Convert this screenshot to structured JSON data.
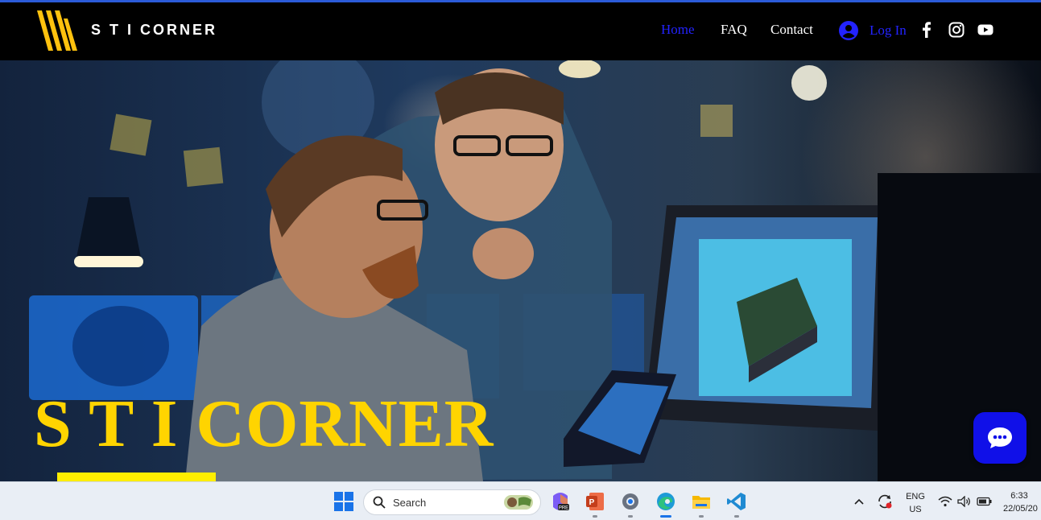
{
  "brand": {
    "name": "S T I CORNER",
    "logo_color": "#ffc20e"
  },
  "nav": {
    "links": [
      {
        "label": "Home",
        "active": true
      },
      {
        "label": "FAQ",
        "active": false
      },
      {
        "label": "Contact",
        "active": false
      }
    ],
    "login_label": "Log In",
    "accent": "#2323ff",
    "social": [
      "facebook-icon",
      "instagram-icon",
      "youtube-icon"
    ]
  },
  "hero": {
    "title": "S T I CORNER",
    "title_color": "#ffd400"
  },
  "chat": {
    "icon": "chat-bubble-icon",
    "color": "#1010e8"
  },
  "taskbar": {
    "search_placeholder": "Search",
    "apps": [
      "windows-start-icon",
      "copilot-icon",
      "powerpoint-icon",
      "settings-icon",
      "edge-icon",
      "file-explorer-icon",
      "vscode-icon"
    ],
    "language": "ENG",
    "region": "US",
    "time": "6:33",
    "date": "22/05/20"
  }
}
